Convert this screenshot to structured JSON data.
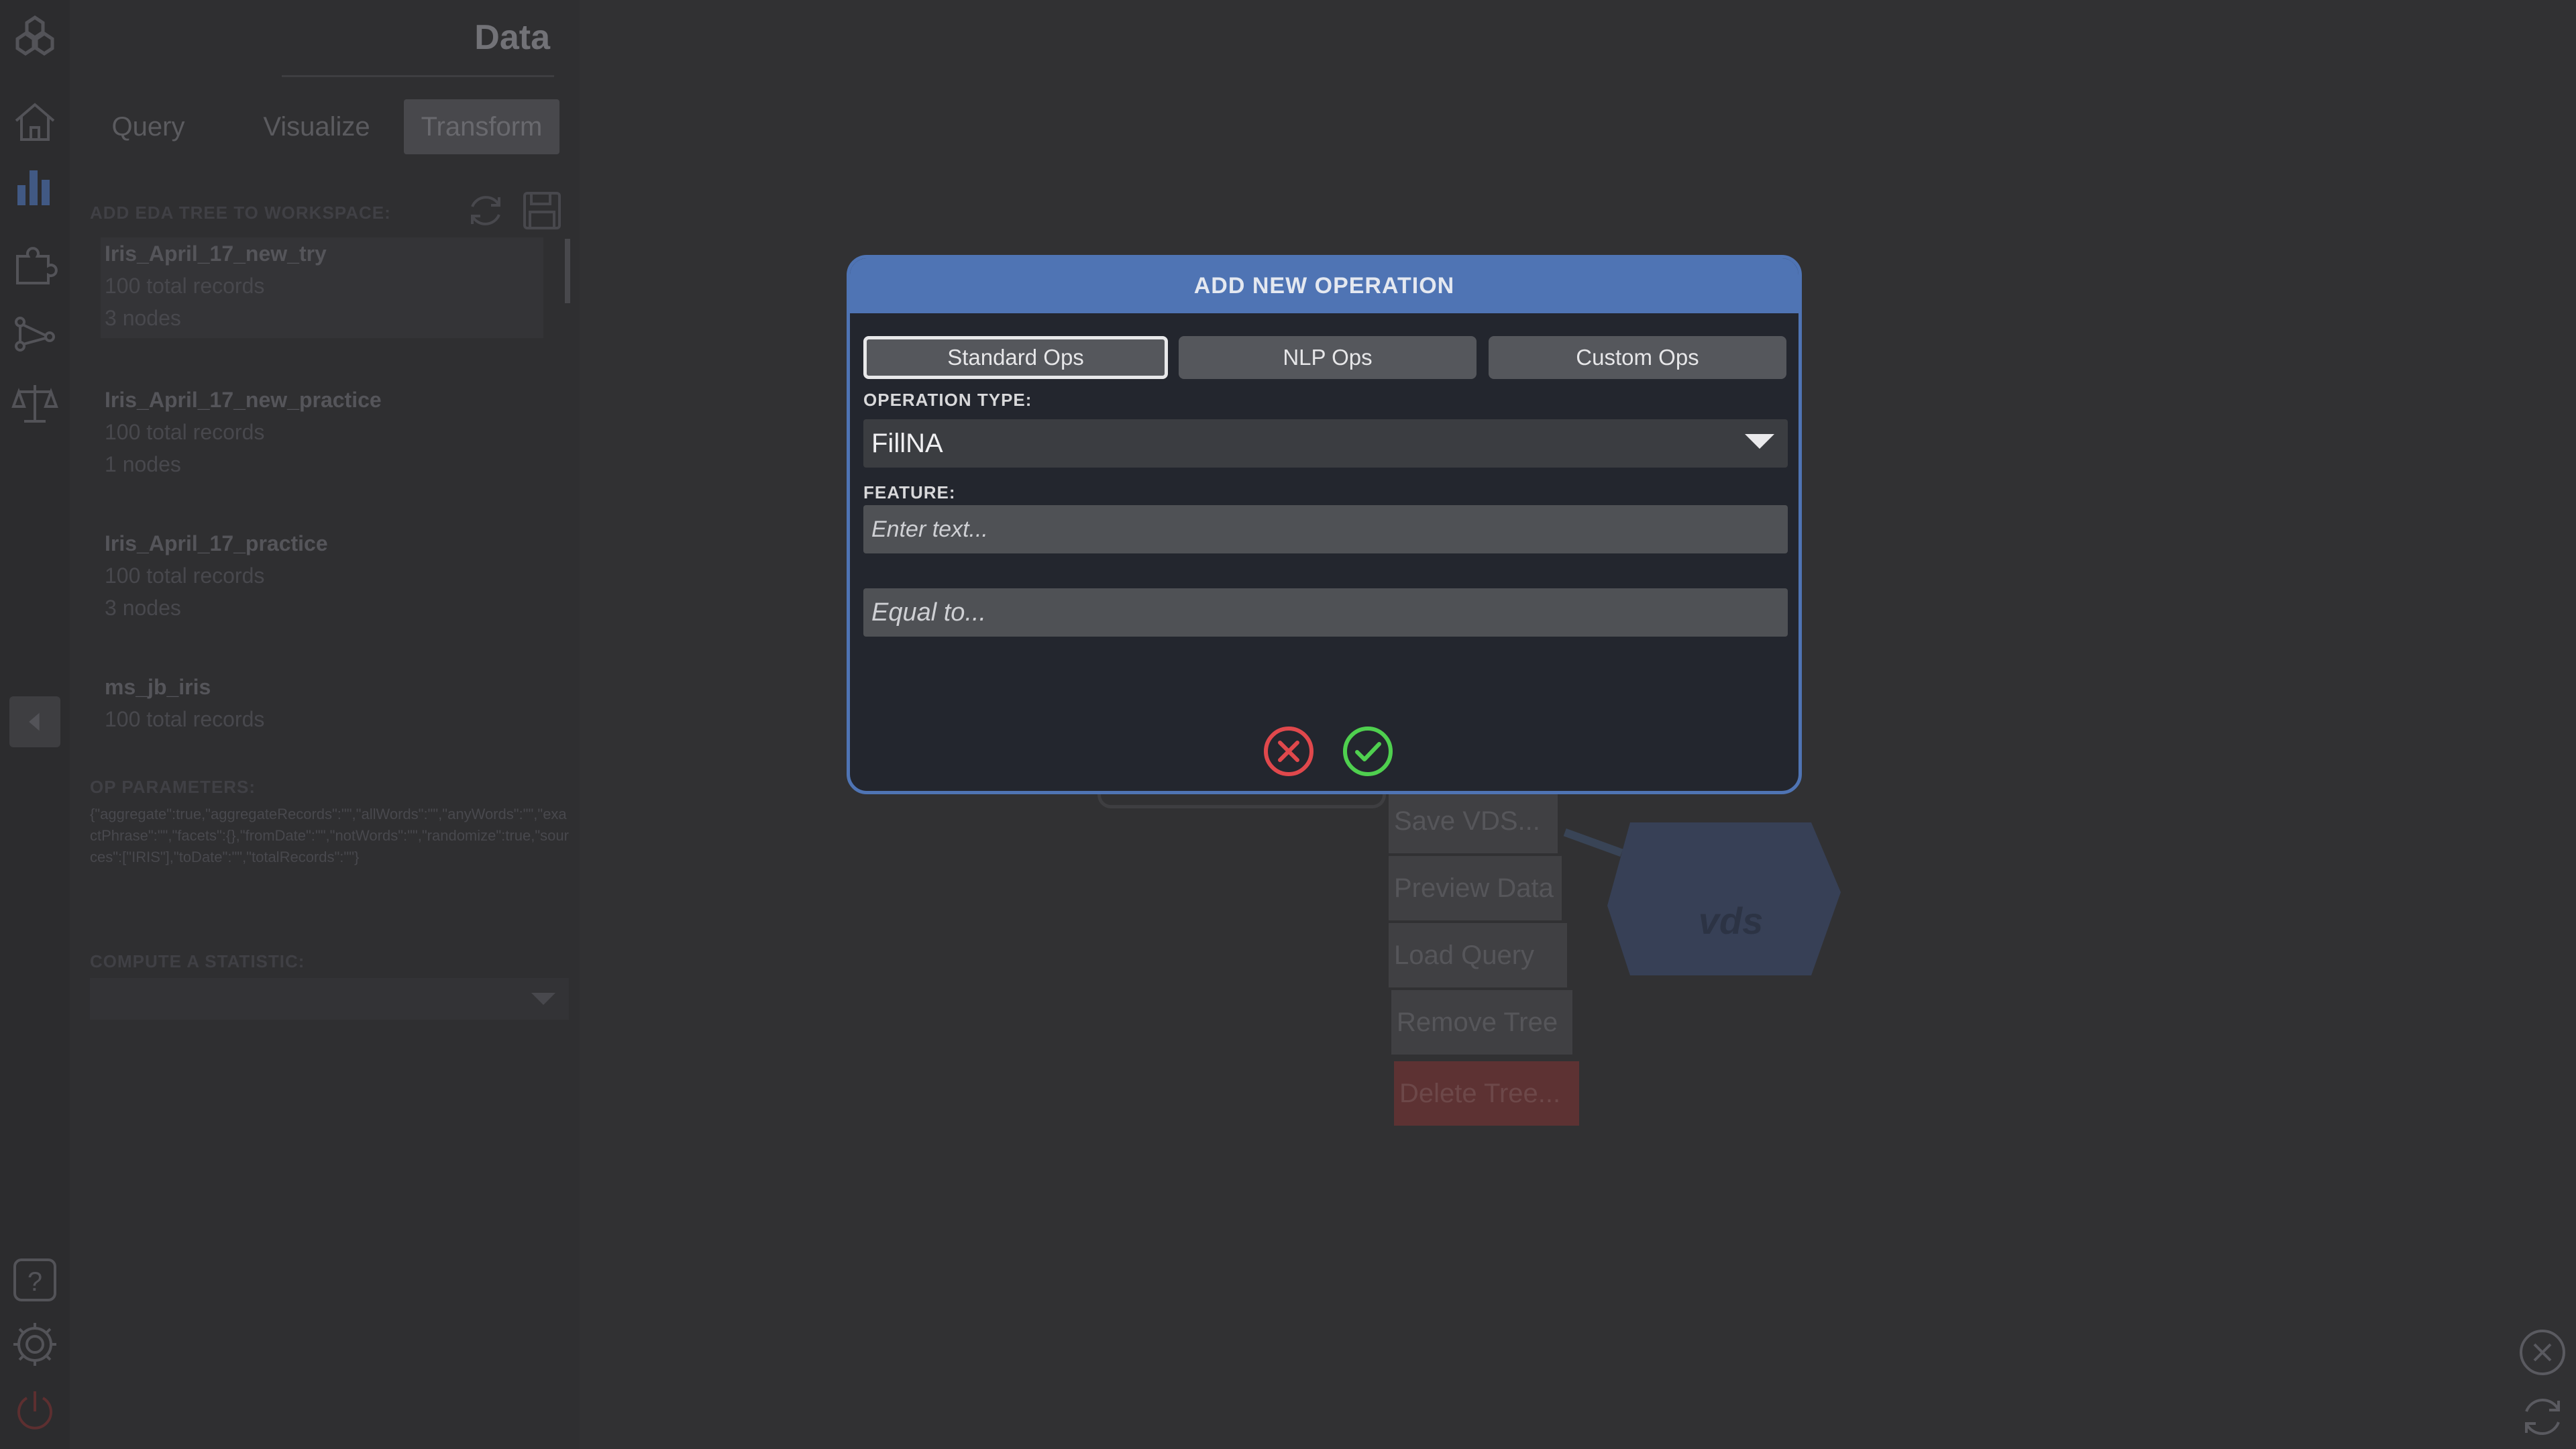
{
  "sidebar": {
    "icons": [
      "logo-icon",
      "home-icon",
      "bar-chart-icon",
      "puzzle-icon",
      "graph-icon",
      "balance-scale-icon",
      "collapse-left-icon",
      "help-icon",
      "gear-icon",
      "power-icon"
    ]
  },
  "panel": {
    "title": "Data",
    "tabs": [
      {
        "label": "Query"
      },
      {
        "label": "Visualize"
      },
      {
        "label": "Transform"
      }
    ],
    "add_tree_label": "ADD EDA TREE TO WORKSPACE:",
    "trees": [
      {
        "name": "Iris_April_17_new_try",
        "records": "100 total records",
        "nodes": "3 nodes"
      },
      {
        "name": "Iris_April_17_new_practice",
        "records": "100 total records",
        "nodes": "1 nodes"
      },
      {
        "name": "Iris_April_17_practice",
        "records": "100 total records",
        "nodes": "3 nodes"
      },
      {
        "name": "ms_jb_iris",
        "records": "100 total records",
        "nodes": ""
      }
    ],
    "op_params_label": "OP PARAMETERS:",
    "op_params_text": "{\"aggregate\":true,\"aggregateRecords\":\"\",\"allWords\":\"\",\"anyWords\":\"\",\"exactPhrase\":\"\",\"facets\":{},\"fromDate\":\"\",\"notWords\":\"\",\"randomize\":true,\"sources\":[\"IRIS\"],\"toDate\":\"\",\"totalRecords\":\"\"}",
    "compute_label": "COMPUTE A STATISTIC:"
  },
  "workspace": {
    "menu": [
      "Save VDS...",
      "Preview Data",
      "Load Query",
      "Remove Tree",
      "Delete Tree..."
    ],
    "node_label": "vds"
  },
  "dialog": {
    "title": "ADD NEW OPERATION",
    "tabs": [
      {
        "label": "Standard Ops",
        "selected": true
      },
      {
        "label": "NLP Ops"
      },
      {
        "label": "Custom Ops"
      }
    ],
    "operation_type_label": "OPERATION TYPE:",
    "operation_type_value": "FillNA",
    "feature_label": "FEATURE:",
    "feature_placeholder": "Enter text...",
    "equal_placeholder": "Equal to...",
    "cancel_color": "#e0484c",
    "confirm_color": "#4fd04f"
  },
  "colors": {
    "accent": "#4f74b4",
    "delete": "#7a3838"
  }
}
